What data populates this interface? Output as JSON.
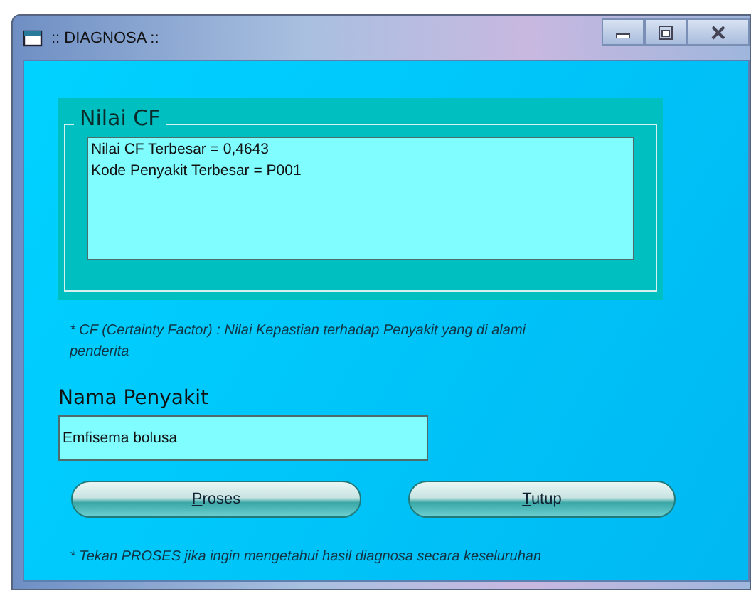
{
  "window": {
    "title": ":: DIAGNOSA ::"
  },
  "cf_group": {
    "title": "Nilai CF",
    "lines": [
      "Nilai CF Terbesar = 0,4643",
      "Kode Penyakit Terbesar = P001"
    ]
  },
  "cf_note": "* CF (Certainty Factor) : Nilai Kepastian terhadap Penyakit yang di alami penderita",
  "disease": {
    "label": "Nama Penyakit",
    "value": "Emfisema bolusa"
  },
  "buttons": [
    {
      "label": "Proses",
      "first_letter_underlined": true
    },
    {
      "label": "Tutup",
      "first_letter_underlined": true
    }
  ],
  "footer_note": "* Tekan PROSES jika ingin mengetahui hasil diagnosa secara keseluruhan"
}
